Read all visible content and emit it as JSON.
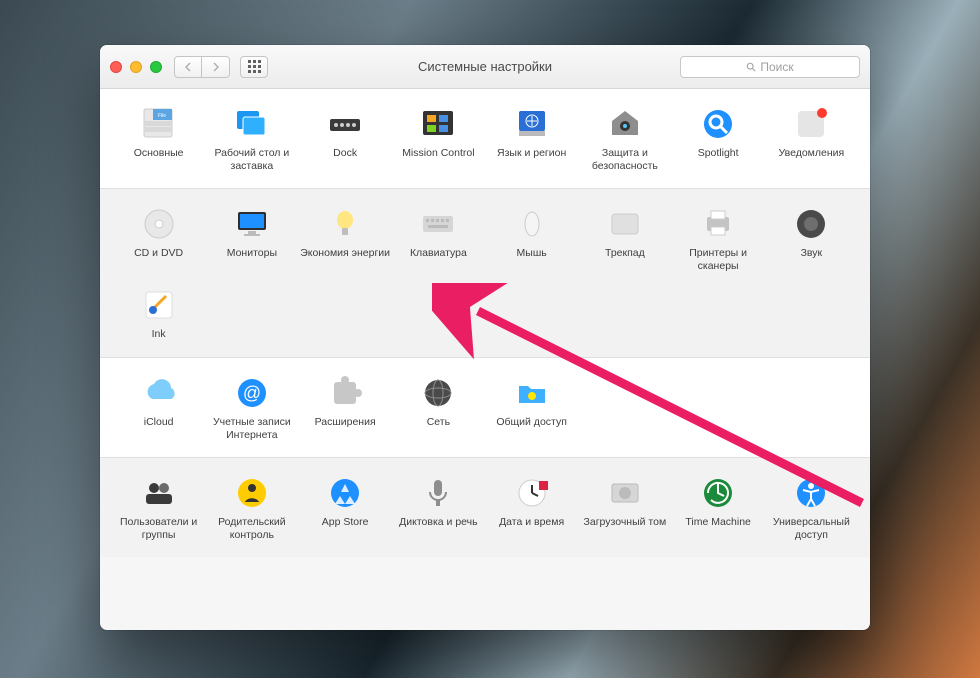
{
  "window": {
    "title": "Системные настройки",
    "search_placeholder": "Поиск"
  },
  "sections": [
    {
      "bg": "sec1",
      "items": [
        {
          "id": "general",
          "label": "Основные",
          "icon": "general"
        },
        {
          "id": "desktop",
          "label": "Рабочий стол и заставка",
          "icon": "desktop"
        },
        {
          "id": "dock",
          "label": "Dock",
          "icon": "dock"
        },
        {
          "id": "mission",
          "label": "Mission Control",
          "icon": "mission"
        },
        {
          "id": "language",
          "label": "Язык и регион",
          "icon": "flag"
        },
        {
          "id": "security",
          "label": "Защита и безопасность",
          "icon": "house"
        },
        {
          "id": "spotlight",
          "label": "Spotlight",
          "icon": "spotlight"
        },
        {
          "id": "notifications",
          "label": "Уведомления",
          "icon": "notify"
        }
      ]
    },
    {
      "bg": "sec2",
      "items": [
        {
          "id": "cddvd",
          "label": "CD и DVD",
          "icon": "disc"
        },
        {
          "id": "displays",
          "label": "Мониторы",
          "icon": "display"
        },
        {
          "id": "energy",
          "label": "Экономия энергии",
          "icon": "bulb"
        },
        {
          "id": "keyboard",
          "label": "Клавиатура",
          "icon": "keyboard"
        },
        {
          "id": "mouse",
          "label": "Мышь",
          "icon": "mouse"
        },
        {
          "id": "trackpad",
          "label": "Трекпад",
          "icon": "trackpad"
        },
        {
          "id": "printers",
          "label": "Принтеры и сканеры",
          "icon": "printer"
        },
        {
          "id": "sound",
          "label": "Звук",
          "icon": "speaker"
        },
        {
          "id": "ink",
          "label": "Ink",
          "icon": "ink"
        }
      ]
    },
    {
      "bg": "sec3",
      "items": [
        {
          "id": "icloud",
          "label": "iCloud",
          "icon": "icloud"
        },
        {
          "id": "accounts",
          "label": "Учетные записи Интернета",
          "icon": "at"
        },
        {
          "id": "extensions",
          "label": "Расширения",
          "icon": "puzzle"
        },
        {
          "id": "network",
          "label": "Сеть",
          "icon": "globe"
        },
        {
          "id": "sharing",
          "label": "Общий доступ",
          "icon": "folder"
        }
      ]
    },
    {
      "bg": "sec4",
      "items": [
        {
          "id": "users",
          "label": "Пользователи и группы",
          "icon": "users"
        },
        {
          "id": "parental",
          "label": "Родительский контроль",
          "icon": "parental"
        },
        {
          "id": "appstore",
          "label": "App Store",
          "icon": "appstore"
        },
        {
          "id": "dictation",
          "label": "Диктовка и речь",
          "icon": "mic"
        },
        {
          "id": "datetime",
          "label": "Дата и время",
          "icon": "clock"
        },
        {
          "id": "startup",
          "label": "Загрузочный том",
          "icon": "hdd"
        },
        {
          "id": "tm",
          "label": "Time Machine",
          "icon": "tm"
        },
        {
          "id": "access",
          "label": "Универсальный доступ",
          "icon": "access"
        }
      ]
    }
  ],
  "annotation_arrow": {
    "target": "keyboard",
    "color": "#e91e63"
  }
}
